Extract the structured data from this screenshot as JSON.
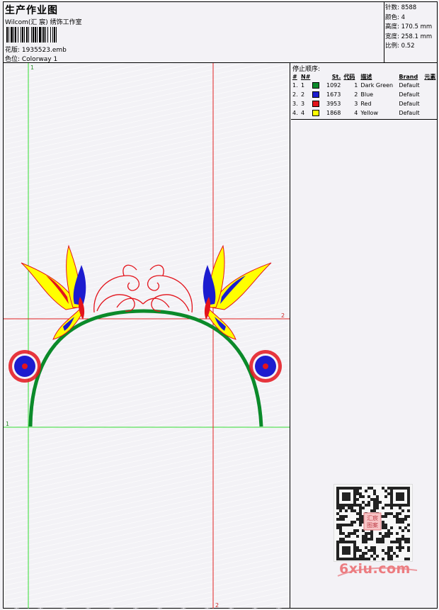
{
  "header": {
    "title": "生产作业图",
    "studio": "Wilcom(汇 宸) 绣饰工作室",
    "design_file": "花版: 1935523.emb",
    "colorway": "色位: Colorway 1"
  },
  "stats": {
    "stitches": "针数: 8588",
    "colors": "颜色: 4",
    "height": "高度: 170.5 mm",
    "width": "宽度: 258.1 mm",
    "scale": "比例: 0.52"
  },
  "stop_sequence": {
    "title": "停止顺序:",
    "headers": [
      "#",
      "N#",
      "St.",
      "代码",
      "描述",
      "Brand",
      "元素"
    ],
    "rows": [
      {
        "idx": "1.",
        "n": "1",
        "stitches": "1092",
        "code": "1",
        "desc": "Dark Green",
        "brand": "Default",
        "color": "#0b8a2a"
      },
      {
        "idx": "2.",
        "n": "2",
        "stitches": "1673",
        "code": "2",
        "desc": "Blue",
        "brand": "Default",
        "color": "#1c1ccf"
      },
      {
        "idx": "3.",
        "n": "3",
        "stitches": "3953",
        "code": "3",
        "desc": "Red",
        "brand": "Default",
        "color": "#e3141c"
      },
      {
        "idx": "4.",
        "n": "4",
        "stitches": "1868",
        "code": "4",
        "desc": "Yellow",
        "brand": "Default",
        "color": "#ffff00"
      }
    ]
  },
  "guides": {
    "green_vertical_label": "1",
    "green_horizontal_label": "1",
    "red_horizontal_label": "2",
    "red_vertical_label": "2"
  },
  "watermark": {
    "site": "6xiu.com",
    "seal": "汇宸\n图案"
  },
  "colors": {
    "green": "#0b8a2a",
    "blue": "#1c1ccf",
    "red": "#e3141c",
    "yellow": "#ffff00",
    "guide_green": "#33dd33",
    "guide_red": "#e22222"
  }
}
